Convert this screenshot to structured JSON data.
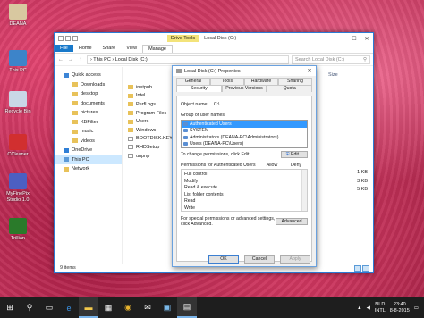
{
  "desktop": {
    "icons": [
      {
        "label": "DEANA",
        "color": "#d8c8a0"
      },
      {
        "label": "This PC",
        "color": "#3d84c9"
      },
      {
        "label": "Recycle Bin",
        "color": "#c9d7e6"
      },
      {
        "label": "CCleaner",
        "color": "#d12f2f"
      },
      {
        "label": "MyFinePix Studio 1.0",
        "color": "#4c5fc2"
      },
      {
        "label": "Trillian",
        "color": "#2a7a2a"
      }
    ]
  },
  "explorer": {
    "drive_tools": "Drive Tools",
    "title": "Local Disk (C:)",
    "ribbon_tabs": [
      "File",
      "Home",
      "Share",
      "View",
      "Manage"
    ],
    "address": "› This PC › Local Disk (C:)",
    "search_placeholder": "Search Local Disk (C:)",
    "column_size": "Size",
    "nav": [
      {
        "label": "Quick access",
        "icon": "star-icon",
        "level": 0,
        "selected": false
      },
      {
        "label": "Downloads",
        "icon": "download-icon",
        "level": 1,
        "selected": false
      },
      {
        "label": "desktop",
        "icon": "folder-icon",
        "level": 1,
        "selected": false
      },
      {
        "label": "documents",
        "icon": "folder-icon",
        "level": 1,
        "selected": false
      },
      {
        "label": "pictures",
        "icon": "folder-icon",
        "level": 1,
        "selected": false
      },
      {
        "label": "KBFilter",
        "icon": "folder-icon",
        "level": 1,
        "selected": false
      },
      {
        "label": "music",
        "icon": "music-icon",
        "level": 1,
        "selected": false
      },
      {
        "label": "videos",
        "icon": "video-icon",
        "level": 1,
        "selected": false
      },
      {
        "label": "OneDrive",
        "icon": "cloud-icon",
        "level": 0,
        "selected": false
      },
      {
        "label": "This PC",
        "icon": "computer-icon",
        "level": 0,
        "selected": true
      },
      {
        "label": "Network",
        "icon": "network-icon",
        "level": 0,
        "selected": false
      }
    ],
    "files": [
      {
        "name": "inetpub",
        "type": "folder"
      },
      {
        "name": "Intel",
        "type": "folder"
      },
      {
        "name": "PerfLogs",
        "type": "folder"
      },
      {
        "name": "Program Files",
        "type": "folder"
      },
      {
        "name": "Users",
        "type": "folder"
      },
      {
        "name": "Windows",
        "type": "folder"
      },
      {
        "name": "BOOTDISK.KEY",
        "type": "file"
      },
      {
        "name": "RHDSetup",
        "type": "file"
      },
      {
        "name": "unpnp",
        "type": "file"
      }
    ],
    "sizes": [
      "1 KB",
      "3 KB",
      "5 KB"
    ],
    "status": "9 items"
  },
  "dialog": {
    "title": "Local Disk (C:) Properties",
    "tabs_row1": [
      "General",
      "Tools",
      "Hardware",
      "Sharing"
    ],
    "tabs_row2": [
      "Security",
      "Previous Versions",
      "Quota"
    ],
    "object_name_label": "Object name:",
    "object_name_value": "C:\\",
    "group_label": "Group or user names:",
    "users": [
      {
        "name": "Authenticated Users",
        "selected": true
      },
      {
        "name": "SYSTEM",
        "selected": false
      },
      {
        "name": "Administrators (DEANA-PC\\Administrators)",
        "selected": false
      },
      {
        "name": "Users (DEANA-PC\\Users)",
        "selected": false
      }
    ],
    "change_perm_text": "To change permissions, click Edit.",
    "edit_label": "Edit...",
    "perm_header": "Permissions for Authenticated Users",
    "allow_label": "Allow",
    "deny_label": "Deny",
    "permissions": [
      "Full control",
      "Modify",
      "Read & execute",
      "List folder contents",
      "Read",
      "Write"
    ],
    "special_text": "For special permissions or advanced settings, click Advanced.",
    "advanced_label": "Advanced",
    "ok_label": "OK",
    "cancel_label": "Cancel",
    "apply_label": "Apply"
  },
  "taskbar": {
    "start_glyph": "⊞",
    "search_glyph": "⚲",
    "taskview_glyph": "▭",
    "apps": [
      "e",
      "▬",
      "▦",
      "◉",
      "✉",
      "▣",
      "▤"
    ],
    "lang_top": "NLD",
    "lang_bottom": "INTL",
    "time": "23:40",
    "date": "8-8-2015"
  }
}
